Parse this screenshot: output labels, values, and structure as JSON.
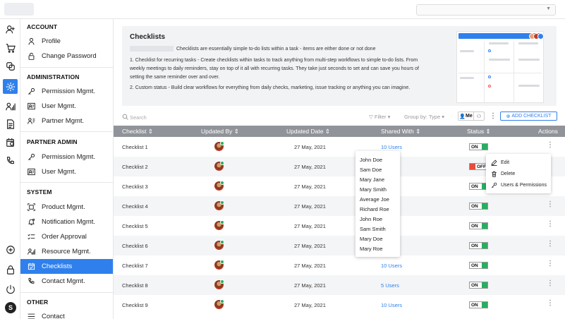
{
  "app": {
    "top_select_value": ""
  },
  "rail": [
    {
      "icon": "add-user-icon"
    },
    {
      "icon": "cart-icon"
    },
    {
      "icon": "layers-icon"
    },
    {
      "icon": "gear-icon",
      "active": true
    },
    {
      "icon": "user-stats-icon"
    },
    {
      "icon": "document-icon"
    },
    {
      "icon": "calendar-clock-icon"
    },
    {
      "icon": "phone-icon"
    }
  ],
  "rail_bottom": [
    {
      "icon": "plus-circle-icon"
    },
    {
      "icon": "lock-icon"
    },
    {
      "icon": "power-icon"
    }
  ],
  "user_initial": "S",
  "nav": {
    "account": {
      "heading": "ACCOUNT",
      "items": [
        {
          "label": "Profile",
          "icon": "person-icon"
        },
        {
          "label": "Change Password",
          "icon": "lock-icon"
        }
      ]
    },
    "administration": {
      "heading": "ADMINISTRATION",
      "items": [
        {
          "label": "Permission Mgmt.",
          "icon": "key-icon"
        },
        {
          "label": "User Mgmt.",
          "icon": "id-card-icon"
        },
        {
          "label": "Partner Mgmt.",
          "icon": "partner-icon"
        }
      ]
    },
    "partner_admin": {
      "heading": "PARTNER ADMIN",
      "items": [
        {
          "label": "Permission Mgmt.",
          "icon": "key-icon"
        },
        {
          "label": "User Mgmt.",
          "icon": "id-card-icon"
        }
      ]
    },
    "system": {
      "heading": "SYSTEM",
      "items": [
        {
          "label": "Product Mgmt.",
          "icon": "product-icon"
        },
        {
          "label": "Notification Mgmt.",
          "icon": "bell-icon"
        },
        {
          "label": "Order Approval",
          "icon": "checklist-icon"
        },
        {
          "label": "Resource Mgmt.",
          "icon": "resource-icon"
        },
        {
          "label": "Checklists",
          "icon": "calendar-check-icon",
          "active": true
        },
        {
          "label": "Contact Mgmt.",
          "icon": "phone-icon"
        }
      ]
    },
    "other": {
      "heading": "OTHER",
      "items": [
        {
          "label": "Contact",
          "icon": "list-icon"
        }
      ]
    }
  },
  "info": {
    "title": "Checklists",
    "line1": "Checklists are essentially simple to-do lists within a task - items are either done or not done",
    "line2": "1. Checklist for recurring tasks - Create checklists within tasks to track anything from multi-step workflows to simple to-do lists. From weekly meetings to daily reminders, stay on top of it all with recurring tasks. They take just seconds to set and can save you hours of setting the same reminder over and over.",
    "line3": "2. Custom status - Build clear workflows for everything from daily checks, marketing, issue tracking or anything you can imagine."
  },
  "toolbar": {
    "search_placeholder": "Search",
    "filter_label": "Filter",
    "group_by_label": "Group by: Type",
    "me_label": "Me",
    "add_label": "ADD CHECKLIST"
  },
  "table": {
    "headers": [
      "Checklist",
      "Updated By",
      "Updated Date",
      "Shared With",
      "Status",
      "Actions"
    ],
    "rows": [
      {
        "name": "Checklist 1",
        "date": "27 May, 2021",
        "shared": "10 Users",
        "status": "ON"
      },
      {
        "name": "Checklist 2",
        "date": "27 May, 2021",
        "shared": "",
        "status": "OFF"
      },
      {
        "name": "Checklist 3",
        "date": "27 May, 2021",
        "shared": "",
        "status": "ON"
      },
      {
        "name": "Checklist 4",
        "date": "27 May, 2021",
        "shared": "",
        "status": "ON"
      },
      {
        "name": "Checklist 5",
        "date": "27 May, 2021",
        "shared": "",
        "status": "ON"
      },
      {
        "name": "Checklist 6",
        "date": "27 May, 2021",
        "shared": "",
        "status": "ON"
      },
      {
        "name": "Checklist 7",
        "date": "27 May, 2021",
        "shared": "10 Users",
        "status": "ON"
      },
      {
        "name": "Checklist 8",
        "date": "27 May, 2021",
        "shared": "5 Users",
        "status": "ON"
      },
      {
        "name": "Checklist 9",
        "date": "27 May, 2021",
        "shared": "10 Users",
        "status": "ON"
      }
    ]
  },
  "users_popup": [
    "John Doe",
    "Sam Doe",
    "Mary Jane",
    "Mary Smith",
    "Average Joe",
    "Richard Roe",
    "John Roe",
    "Sam Smith",
    "Mary Doe",
    "Mary Roe"
  ],
  "actions_popup": [
    {
      "label": "Edit",
      "icon": "pencil-icon"
    },
    {
      "label": "Delete",
      "icon": "trash-icon"
    },
    {
      "label": "Users & Permissions",
      "icon": "key-icon"
    }
  ],
  "colors": {
    "accent": "#2f80ed",
    "header_bg": "#909399",
    "on": "#27ae60",
    "off": "#e74c3c"
  }
}
